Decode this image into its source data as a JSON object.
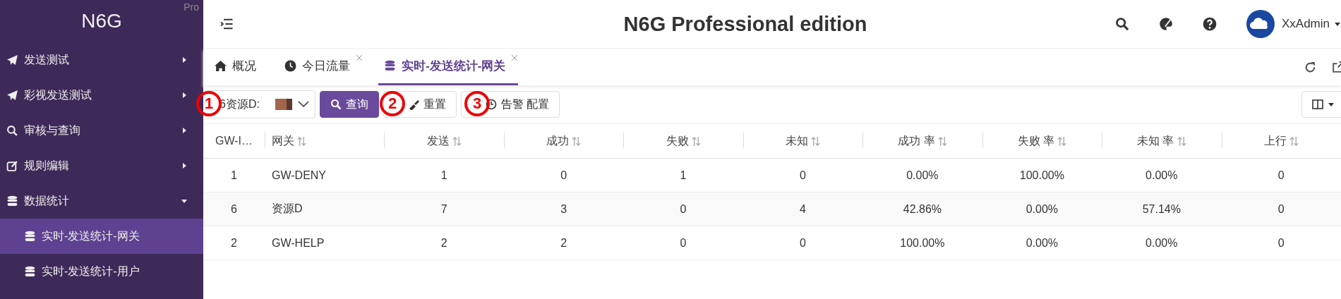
{
  "sidebar": {
    "logo": "N6G",
    "badge": "Pro",
    "items": [
      {
        "label": "发送测试",
        "expanded": false
      },
      {
        "label": "彩视发送测试",
        "expanded": false
      },
      {
        "label": "审核与查询",
        "expanded": false
      },
      {
        "label": "规则编辑",
        "expanded": false
      },
      {
        "label": "数据统计",
        "expanded": true,
        "children": [
          {
            "label": "实时-发送统计-网关",
            "selected": true
          },
          {
            "label": "实时-发送统计-用户",
            "selected": false
          }
        ]
      }
    ]
  },
  "header": {
    "title": "N6G Professional edition",
    "user": "XxAdmin"
  },
  "tabs": [
    {
      "label": "概况",
      "closable": false,
      "selected": false
    },
    {
      "label": "今日流量",
      "closable": true,
      "selected": false
    },
    {
      "label": "实时-发送统计-网关",
      "closable": true,
      "selected": true
    }
  ],
  "toolbar": {
    "select_value": "6资源D:",
    "buttons": [
      {
        "label": "查询",
        "kind": "primary"
      },
      {
        "label": "重置",
        "kind": "plain"
      },
      {
        "label": "告警 配置",
        "kind": "plain"
      }
    ]
  },
  "callouts": [
    "1",
    "2",
    "3"
  ],
  "table": {
    "columns": [
      "GW-I…",
      "网关",
      "发送",
      "成功",
      "失败",
      "未知",
      "成功 率",
      "失败 率",
      "未知 率",
      "上行"
    ],
    "rows": [
      [
        "1",
        "GW-DENY",
        "1",
        "0",
        "1",
        "0",
        "0.00%",
        "100.00%",
        "0.00%",
        "0"
      ],
      [
        "6",
        "资源D",
        "7",
        "3",
        "0",
        "4",
        "42.86%",
        "0.00%",
        "57.14%",
        "0"
      ],
      [
        "2",
        "GW-HELP",
        "2",
        "2",
        "0",
        "0",
        "100.00%",
        "0.00%",
        "0.00%",
        "0"
      ]
    ]
  }
}
